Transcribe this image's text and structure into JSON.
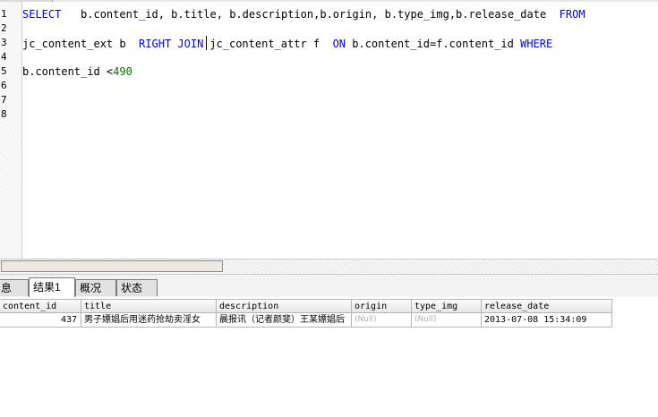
{
  "editor": {
    "top_tab_label": "",
    "line_numbers": [
      "1",
      "2",
      "3",
      "4",
      "5",
      "6",
      "7",
      "8"
    ],
    "line1": {
      "kw_select": "SELECT",
      "columns": "   b.content_id, b.title, b.description,b.origin, b.type_img,b.release_date  ",
      "kw_from": "FROM"
    },
    "line3": {
      "table1": "jc_content_ext b  ",
      "kw_right_join": "RIGHT JOIN",
      "table2": "jc_content_attr f  ",
      "kw_on": "ON",
      "condition": " b.content_id=f.content_id ",
      "kw_where": "WHERE"
    },
    "line5": {
      "expr": "b.content_id <",
      "value": "490"
    }
  },
  "result_tabs": [
    {
      "label": "息"
    },
    {
      "label": "结果1"
    },
    {
      "label": "概况"
    },
    {
      "label": "状态"
    }
  ],
  "grid": {
    "columns": [
      "content_id",
      "title",
      "description",
      "origin",
      "type_img",
      "release_date"
    ],
    "rows": [
      {
        "content_id": "437",
        "title": "男子嫖娼后用迷药抢劫卖淫女",
        "description": "晨报讯（记者颜斐）王某嫖娼后",
        "origin": "(Null)",
        "type_img": "(Null)",
        "release_date": "2013-07-08 15:34:09"
      }
    ]
  }
}
